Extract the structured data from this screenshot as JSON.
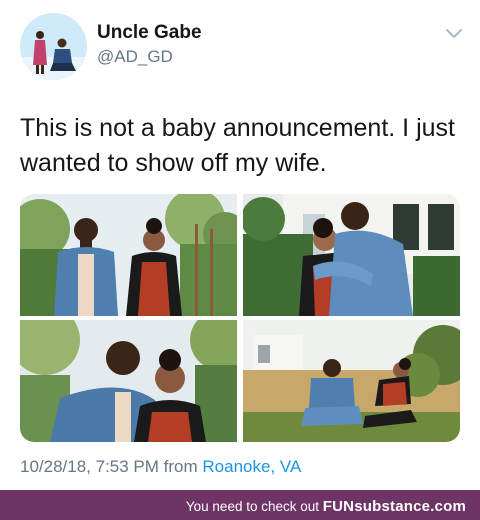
{
  "tweet": {
    "display_name": "Uncle Gabe",
    "handle": "@AD_GD",
    "text": "This is not a baby announcement. I just wanted to show off my wife.",
    "timestamp": "10/28/18, 7:53 PM from",
    "location": "Roanoke, VA",
    "avatar_icon": "profile-photo",
    "menu_icon": "chevron-down-icon",
    "link_color": "#1b95e0"
  },
  "media": {
    "photo_count": 4
  },
  "watermark": {
    "prefix": "You need to check out",
    "brand": "FUNsubstance.com",
    "background": "#6f3466"
  }
}
